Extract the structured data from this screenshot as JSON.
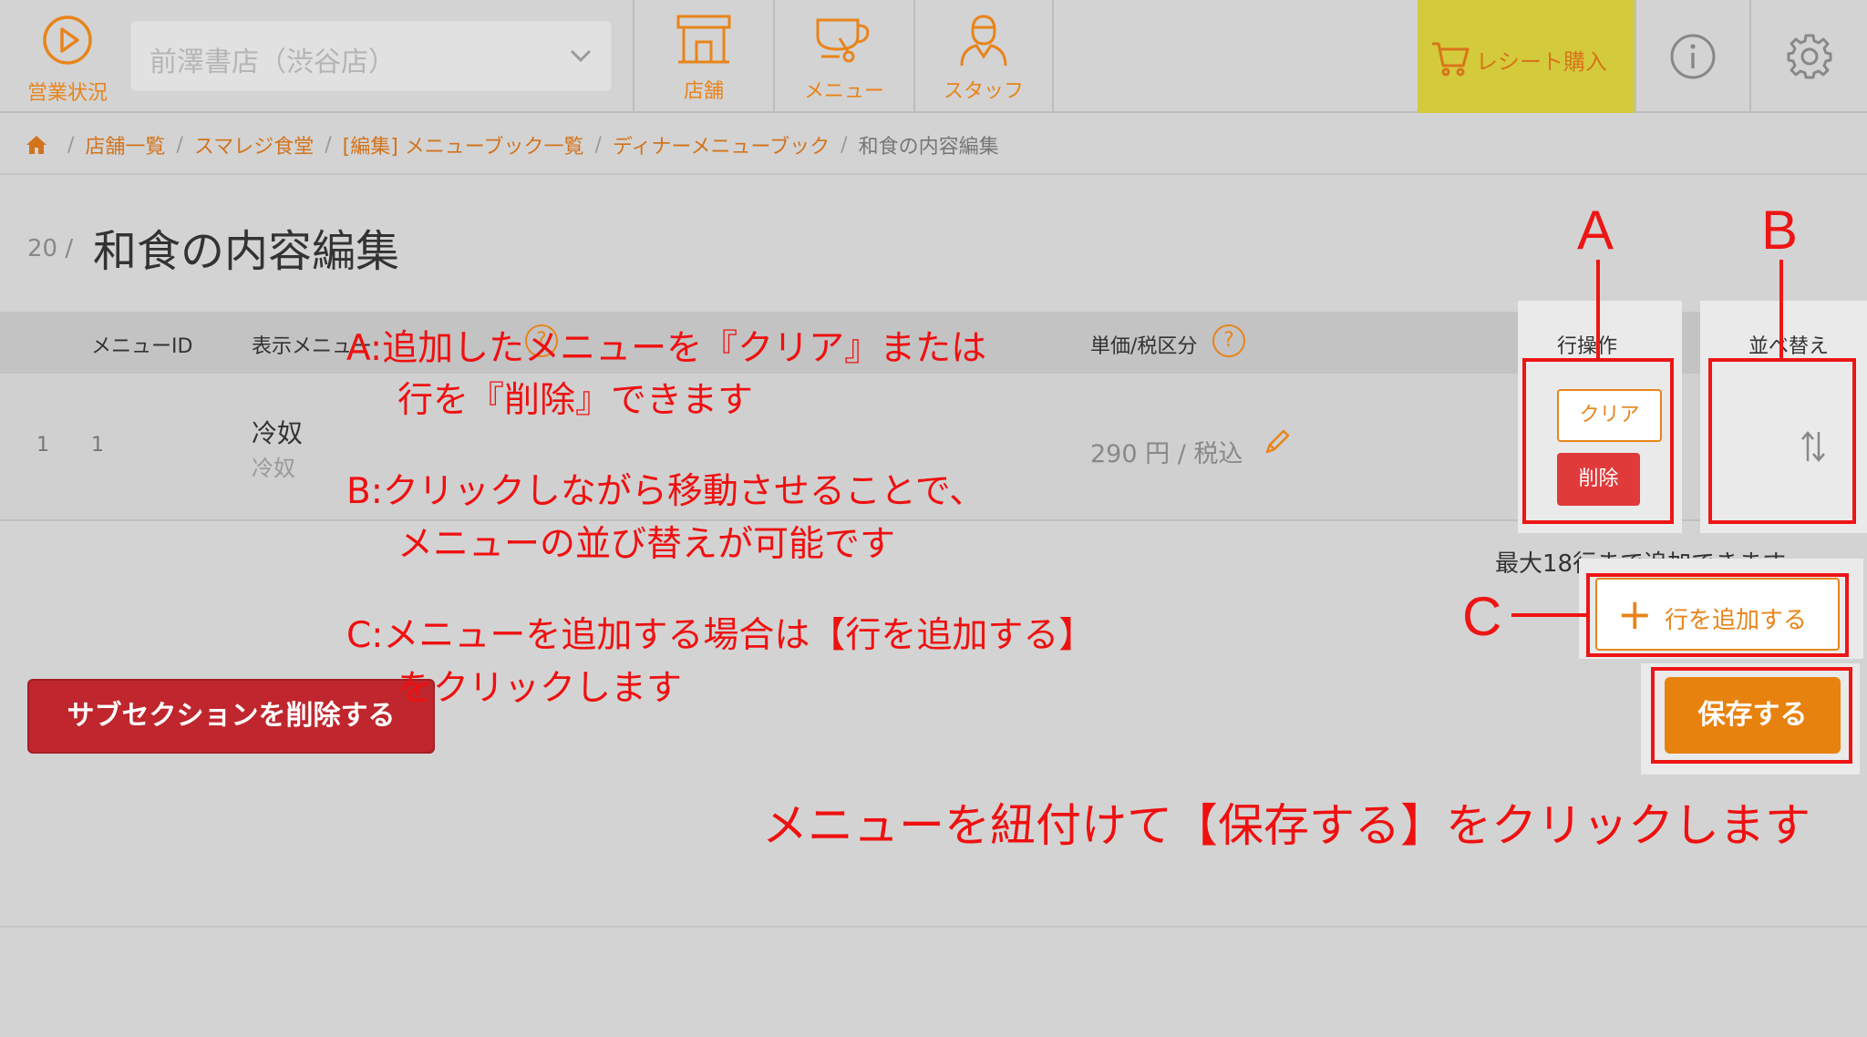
{
  "header": {
    "status_label": "営業状況",
    "store_select_value": "前澤書店（渋谷店）",
    "nav": [
      {
        "label": "店舗",
        "icon": "store-icon"
      },
      {
        "label": "メニュー",
        "icon": "cup-icon"
      },
      {
        "label": "スタッフ",
        "icon": "staff-icon"
      }
    ],
    "receipt_label": "レシート購入",
    "accent_color": "#e8841a",
    "receipt_bg": "#d3cb3c"
  },
  "breadcrumb": [
    "店舗一覧",
    "スマレジ食堂",
    "[編集] メニューブック一覧",
    "ディナーメニューブック",
    "和食の内容編集"
  ],
  "page": {
    "number": "20 /",
    "title": "和食の内容編集"
  },
  "table": {
    "headers": {
      "menu_id": "メニューID",
      "display_name": "表示メニュー",
      "price_tax": "単価/税区分",
      "row_ops": "行操作",
      "sort": "並べ替え"
    },
    "rows": [
      {
        "no": "1",
        "menu_id": "1",
        "name": "冷奴",
        "sub_name": "冷奴",
        "price": "290 円 / 税込"
      }
    ],
    "clear_label": "クリア",
    "delete_label": "削除"
  },
  "max_rows_text": "最大18行まで追加できます。",
  "add_row_label": "行を追加する",
  "save_label": "保存する",
  "delete_subsection_label": "サブセクションを削除する",
  "annotations": {
    "letter_a": "A",
    "letter_b": "B",
    "letter_c": "C",
    "a_line1": "A:追加したメニューを『クリア』または",
    "a_line2": "行を『削除』できます",
    "b_line1": "B:クリックしながら移動させることで、",
    "b_line2": "メニューの並び替えが可能です",
    "c_line1": "C:メニューを追加する場合は【行を追加する】",
    "c_line2": "をクリックします",
    "bottom": "メニューを紐付けて【保存する】をクリックします",
    "color": "#ee1515"
  }
}
